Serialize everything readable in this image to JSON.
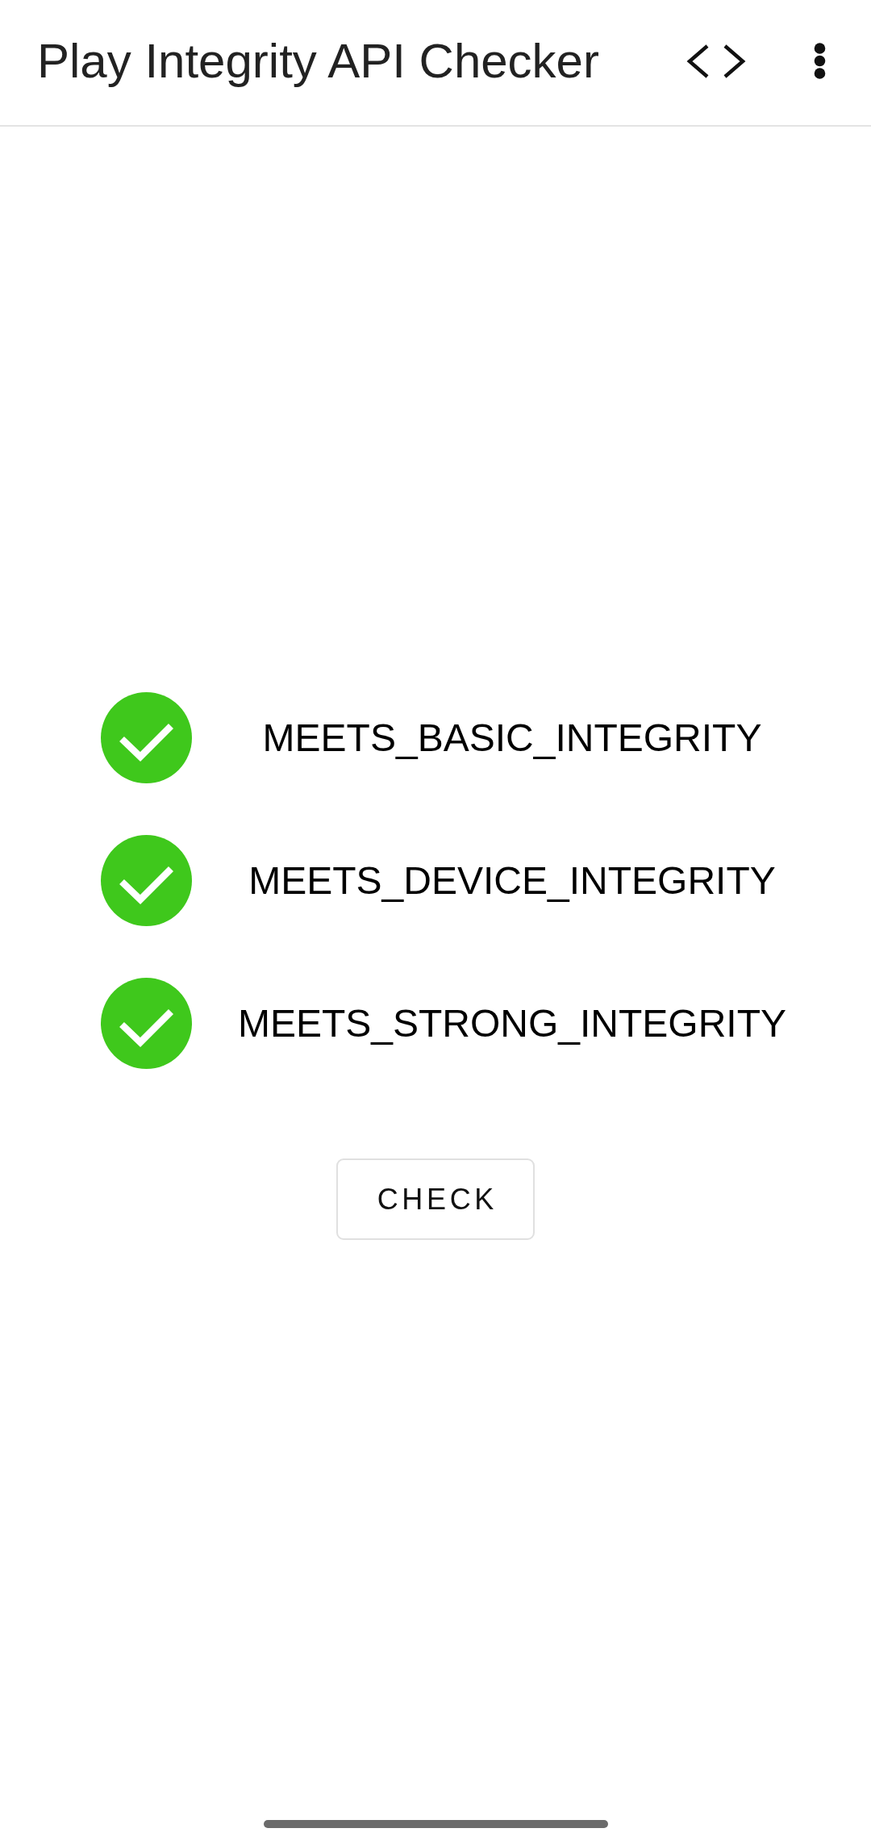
{
  "app_bar": {
    "title": "Play Integrity API Checker"
  },
  "checks": [
    {
      "label": "MEETS_BASIC_INTEGRITY",
      "passed": true
    },
    {
      "label": "MEETS_DEVICE_INTEGRITY",
      "passed": true
    },
    {
      "label": "MEETS_STRONG_INTEGRITY",
      "passed": true
    }
  ],
  "check_button": {
    "label": "CHECK"
  }
}
